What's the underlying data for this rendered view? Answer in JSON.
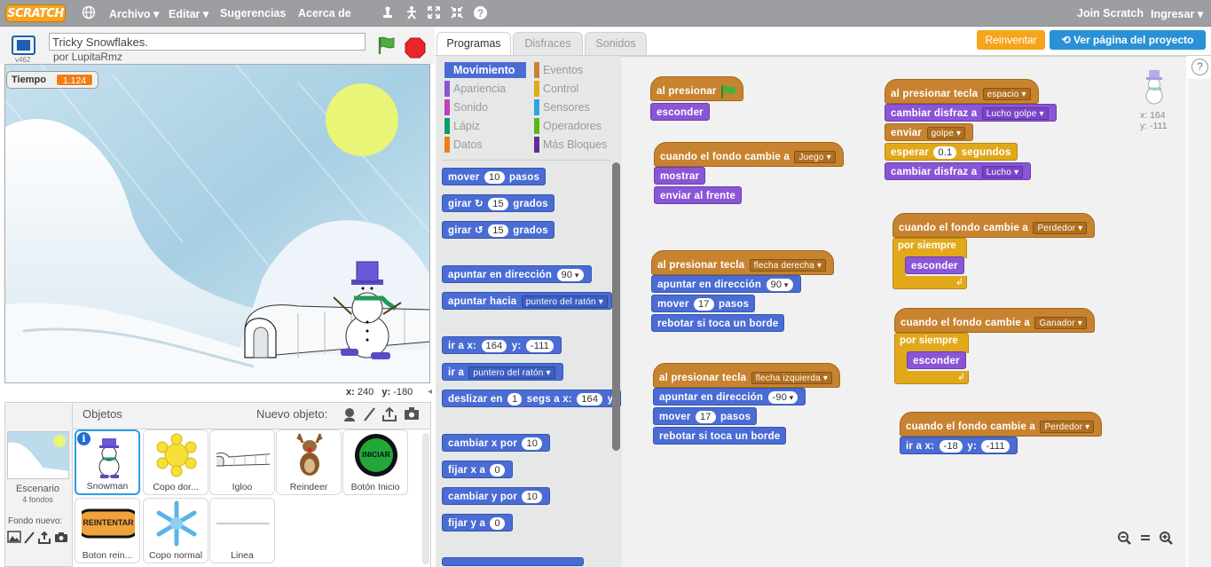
{
  "topbar": {
    "logo": "SCRATCH",
    "menus": [
      "Archivo",
      "Editar",
      "Sugerencias",
      "Acerca de"
    ],
    "join": "Join Scratch",
    "login": "Ingresar"
  },
  "stage_header": {
    "version": "v462",
    "project_title": "Tricky Snowflakes.",
    "author": "por LupitaRmz"
  },
  "monitor": {
    "label": "Tiempo",
    "value": "1.124"
  },
  "mouse_coords": {
    "x_label": "x:",
    "x": "240",
    "y_label": "y:",
    "y": "-180"
  },
  "sprites_panel": {
    "title": "Objetos",
    "new_object": "Nuevo objeto:",
    "stage_label": "Escenario",
    "stage_count": "4 fondos",
    "new_backdrop": "Fondo nuevo:",
    "sprites": [
      {
        "name": "Snowman",
        "selected": true
      },
      {
        "name": "Copo dor..."
      },
      {
        "name": "Igloo"
      },
      {
        "name": "Reindeer"
      },
      {
        "name": "Botón Inicio",
        "button_text": "INICIAR"
      },
      {
        "name": "Boton rein...",
        "button_text": "REINTENTAR"
      },
      {
        "name": "Copo normal"
      },
      {
        "name": "Linea"
      }
    ]
  },
  "tabs": [
    "Programas",
    "Disfraces",
    "Sonidos"
  ],
  "actions": {
    "remix": "Reinventar",
    "see_project": "Ver página del proyecto"
  },
  "categories": {
    "left": [
      {
        "label": "Movimiento",
        "color": "#4a6cd4",
        "active": true
      },
      {
        "label": "Apariencia",
        "color": "#8a55d7"
      },
      {
        "label": "Sonido",
        "color": "#bb42c3"
      },
      {
        "label": "Lápiz",
        "color": "#0e9a6c"
      },
      {
        "label": "Datos",
        "color": "#ee7d16"
      }
    ],
    "right": [
      {
        "label": "Eventos",
        "color": "#c88330"
      },
      {
        "label": "Control",
        "color": "#e1a91a"
      },
      {
        "label": "Sensores",
        "color": "#2ca5e2"
      },
      {
        "label": "Operadores",
        "color": "#5cb712"
      },
      {
        "label": "Más Bloques",
        "color": "#632d99"
      }
    ]
  },
  "palette": {
    "move": {
      "pre": "mover",
      "val": "10",
      "post": "pasos"
    },
    "turn_right": {
      "pre": "girar",
      "val": "15",
      "post": "grados"
    },
    "turn_left": {
      "pre": "girar",
      "val": "15",
      "post": "grados"
    },
    "point_dir": {
      "pre": "apuntar en dirección",
      "val": "90"
    },
    "point_towards": {
      "pre": "apuntar hacia",
      "val": "puntero del ratón"
    },
    "goto_xy": {
      "pre": "ir a x:",
      "x": "164",
      "mid": "y:",
      "y": "-111"
    },
    "goto": {
      "pre": "ir a",
      "val": "puntero del ratón"
    },
    "glide": {
      "pre": "deslizar en",
      "secs": "1",
      "mid": "segs a x:",
      "x": "164",
      "post": "y"
    },
    "change_x": {
      "pre": "cambiar x por",
      "val": "10"
    },
    "set_x": {
      "pre": "fijar x a",
      "val": "0"
    },
    "change_y": {
      "pre": "cambiar y por",
      "val": "10"
    },
    "set_y": {
      "pre": "fijar y a",
      "val": "0"
    }
  },
  "scripts": {
    "s1": {
      "hat": "al presionar",
      "b1": "esconder"
    },
    "s2": {
      "hat": "cuando el fondo cambie a",
      "hat_val": "Juego",
      "b1": "mostrar",
      "b2": "enviar al frente"
    },
    "s3": {
      "hat": "al presionar tecla",
      "hat_val": "flecha derecha",
      "b1": "apuntar en dirección",
      "b1_val": "90",
      "b2": "mover",
      "b2_val": "17",
      "b2_post": "pasos",
      "b3": "rebotar si toca un borde"
    },
    "s4": {
      "hat": "al presionar tecla",
      "hat_val": "flecha izquierda",
      "b1": "apuntar en dirección",
      "b1_val": "-90",
      "b2": "mover",
      "b2_val": "17",
      "b2_post": "pasos",
      "b3": "rebotar si toca un borde"
    },
    "s5": {
      "hat": "al presionar tecla",
      "hat_val": "espacio",
      "b1": "cambiar disfraz a",
      "b1_val": "Lucho golpe",
      "b2": "enviar",
      "b2_val": "golpe",
      "b3": "esperar",
      "b3_val": "0.1",
      "b3_post": "segundos",
      "b4": "cambiar disfraz a",
      "b4_val": "Lucho"
    },
    "s6": {
      "hat": "cuando el fondo cambie a",
      "hat_val": "Perdedor",
      "loop": "por siempre",
      "inner": "esconder"
    },
    "s7": {
      "hat": "cuando el fondo cambie a",
      "hat_val": "Ganador",
      "loop": "por siempre",
      "inner": "esconder"
    },
    "s8": {
      "hat": "cuando el fondo cambie a",
      "hat_val": "Perdedor",
      "b1": "ir a x:",
      "b1_x": "-18",
      "b1_mid": "y:",
      "b1_y": "-111"
    }
  },
  "sprite_info": {
    "x_label": "x:",
    "x": "164",
    "y_label": "y:",
    "y": "-111"
  }
}
